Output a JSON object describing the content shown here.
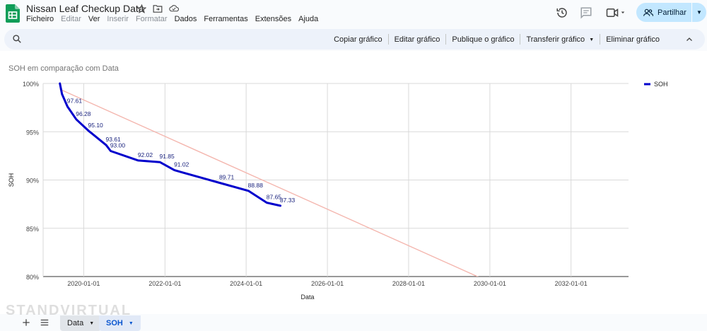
{
  "document": {
    "title": "Nissan Leaf Checkup Data"
  },
  "menu": {
    "items": [
      {
        "label": "Ficheiro",
        "enabled": true
      },
      {
        "label": "Editar",
        "enabled": false
      },
      {
        "label": "Ver",
        "enabled": true
      },
      {
        "label": "Inserir",
        "enabled": false
      },
      {
        "label": "Formatar",
        "enabled": false
      },
      {
        "label": "Dados",
        "enabled": true
      },
      {
        "label": "Ferramentas",
        "enabled": true
      },
      {
        "label": "Extensões",
        "enabled": true
      },
      {
        "label": "Ajuda",
        "enabled": true
      }
    ]
  },
  "share": {
    "label": "Partilhar"
  },
  "chart_toolbar": {
    "actions": [
      {
        "label": "Copiar gráfico",
        "dropdown": false
      },
      {
        "label": "Editar gráfico",
        "dropdown": false
      },
      {
        "label": "Publique o gráfico",
        "dropdown": false
      },
      {
        "label": "Transferir gráfico",
        "dropdown": true
      },
      {
        "label": "Eliminar gráfico",
        "dropdown": false
      }
    ]
  },
  "sheets": {
    "tabs": [
      {
        "label": "Data",
        "active": false
      },
      {
        "label": "SOH",
        "active": true
      }
    ]
  },
  "watermark": "STANDVIRTUAL",
  "colors": {
    "series": "#0000cc",
    "trendline": "#f4b6ae",
    "share_bg": "#c2e7ff",
    "active_tab_text": "#0b57d0"
  },
  "chart_data": {
    "type": "line",
    "title": "SOH em comparação com Data",
    "xlabel": "Data",
    "ylabel": "SOH",
    "xlim": [
      "2019-01-01",
      "2033-06-01"
    ],
    "ylim": [
      80,
      100
    ],
    "x_ticks": [
      "2020-01-01",
      "2022-01-01",
      "2024-01-01",
      "2026-01-01",
      "2028-01-01",
      "2030-01-01",
      "2032-01-01"
    ],
    "y_ticks": [
      80,
      85,
      90,
      95,
      100
    ],
    "y_tick_labels": [
      "80%",
      "85%",
      "90%",
      "95%",
      "100%"
    ],
    "grid": true,
    "legend": "top-right",
    "series": [
      {
        "name": "SOH",
        "x": [
          "2019-06-01",
          "2019-06-20",
          "2019-08-08",
          "2019-10-26",
          "2020-02-13",
          "2020-07-21",
          "2020-08-30",
          "2021-05-05",
          "2021-11-16",
          "2022-03-27",
          "2023-05-07",
          "2024-01-21",
          "2024-07-05",
          "2024-11-04"
        ],
        "values": [
          100,
          98.9,
          97.61,
          96.28,
          95.1,
          93.61,
          93.0,
          92.02,
          91.85,
          91.02,
          89.71,
          88.88,
          87.65,
          87.33
        ],
        "labels": [
          "",
          "",
          "97.61",
          "96.28",
          "95.10",
          "93.61",
          "93.00",
          "92.02",
          "91.85",
          "91.02",
          "89.71",
          "88.88",
          "87.65",
          "87.33"
        ]
      }
    ],
    "trendline": {
      "x": [
        "2019-06-01",
        "2029-10-01"
      ],
      "values": [
        99.4,
        79.9
      ]
    }
  }
}
